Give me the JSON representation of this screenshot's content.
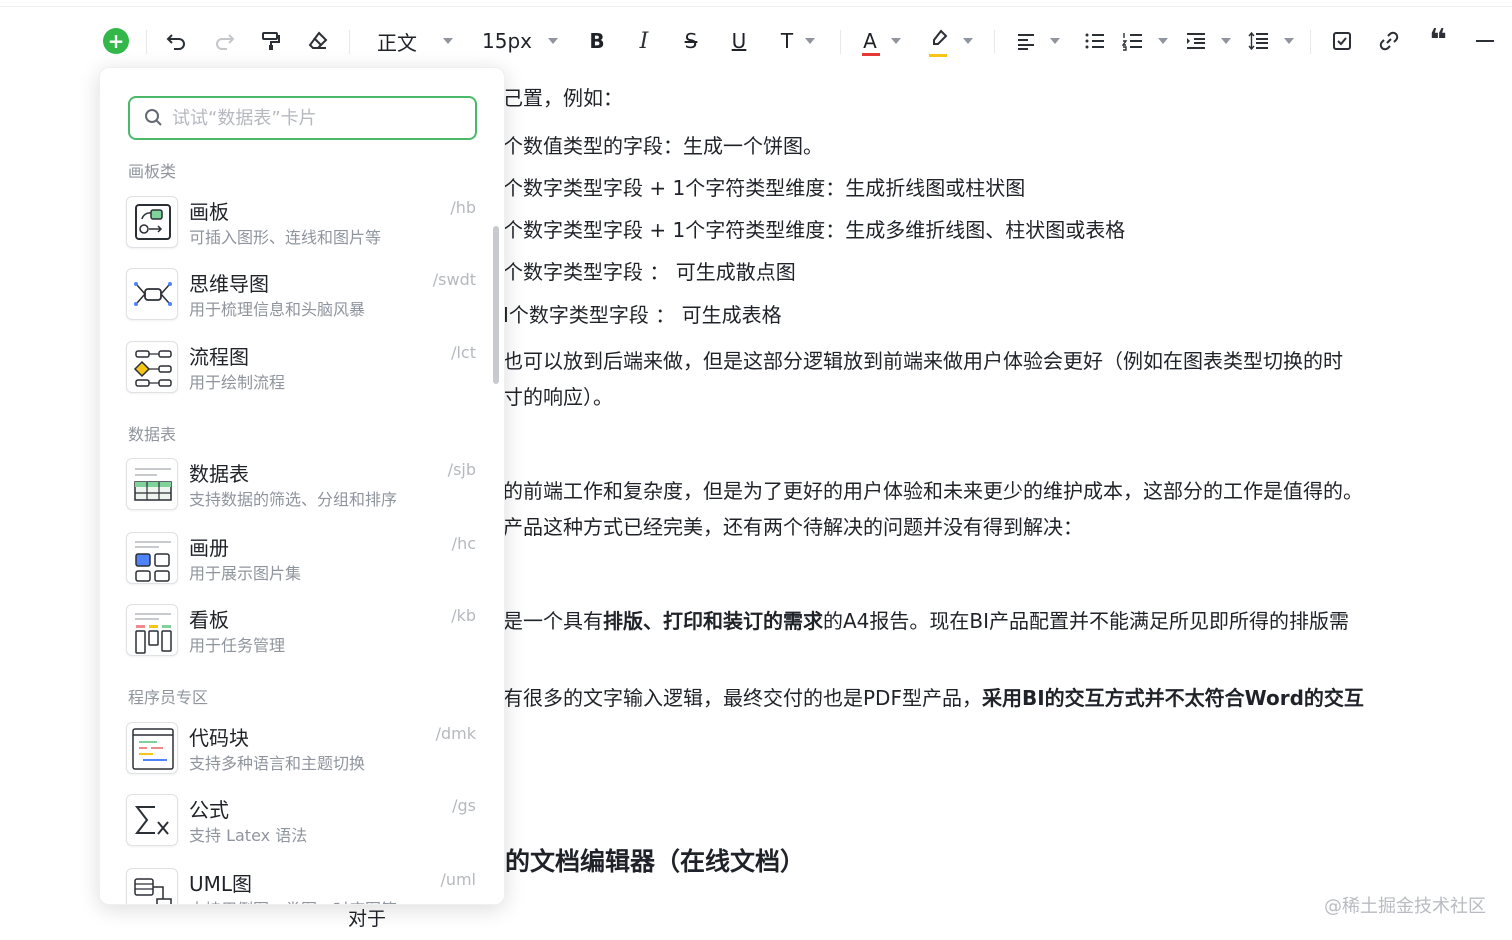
{
  "toolbar": {
    "style_select": "正文",
    "size_select": "15px",
    "bold": "B",
    "italic": "I",
    "strike": "S",
    "underline": "U",
    "clear_format": "T",
    "font_color": "A",
    "quote": "❝"
  },
  "document": {
    "lines": [
      "己置，例如：",
      "个数值类型的字段：生成一个饼图。",
      "个数字类型字段 + 1个字符类型维度：生成折线图或柱状图",
      "个数字类型字段 + 1个字符类型维度：生成多维折线图、柱状图或表格",
      "个数字类型字段 ： 可生成散点图",
      "I个数字类型字段 ： 可生成表格",
      "也可以放到后端来做，但是这部分逻辑放到前端来做用户体验会更好（例如在图表类型切换的时",
      "寸的响应）。",
      "的前端工作和复杂度，但是为了更好的用户体验和未来更少的维护成本，这部分的工作是值得的。",
      "产品这种方式已经完美，还有两个待解决的问题并没有得到解决："
    ],
    "rich1_pre": "是一个具有",
    "rich1_bold": "排版、打印和装订的需求",
    "rich1_post": "的A4报告。现在BI产品配置并不能满足所见即所得的排版需",
    "rich2_pre": "有很多的文字输入逻辑，最终交付的也是PDF型产品，",
    "rich2_bold": "采用BI的交互方式并不太符合Word的交互",
    "heading": "的文档编辑器（在线文档）",
    "bottom": "对于"
  },
  "watermark": "@稀土掘金技术社区",
  "popup": {
    "search_placeholder": "试试“数据表”卡片",
    "sections": [
      "画板类",
      "数据表",
      "程序员专区"
    ],
    "items": [
      {
        "title": "画板",
        "desc": "可插入图形、连线和图片等",
        "shortcut": "/hb",
        "icon": "whiteboard-icon"
      },
      {
        "title": "思维导图",
        "desc": "用于梳理信息和头脑风暴",
        "shortcut": "/swdt",
        "icon": "mindmap-icon"
      },
      {
        "title": "流程图",
        "desc": "用于绘制流程",
        "shortcut": "/lct",
        "icon": "flowchart-icon"
      },
      {
        "title": "数据表",
        "desc": "支持数据的筛选、分组和排序",
        "shortcut": "/sjb",
        "icon": "datatable-icon"
      },
      {
        "title": "画册",
        "desc": "用于展示图片集",
        "shortcut": "/hc",
        "icon": "album-icon"
      },
      {
        "title": "看板",
        "desc": "用于任务管理",
        "shortcut": "/kb",
        "icon": "kanban-icon"
      },
      {
        "title": "代码块",
        "desc": "支持多种语言和主题切换",
        "shortcut": "/dmk",
        "icon": "codeblock-icon"
      },
      {
        "title": "公式",
        "desc": "支持 Latex 语法",
        "shortcut": "/gs",
        "icon": "formula-icon"
      },
      {
        "title": "UML图",
        "desc": "支持用例图、类图、时序图等",
        "shortcut": "/uml",
        "icon": "uml-icon"
      }
    ]
  },
  "colors": {
    "accent_green": "#34b74a",
    "search_border": "#4cb86a",
    "font_color_bar": "#e53935",
    "highlight_bar": "#f5c518"
  }
}
